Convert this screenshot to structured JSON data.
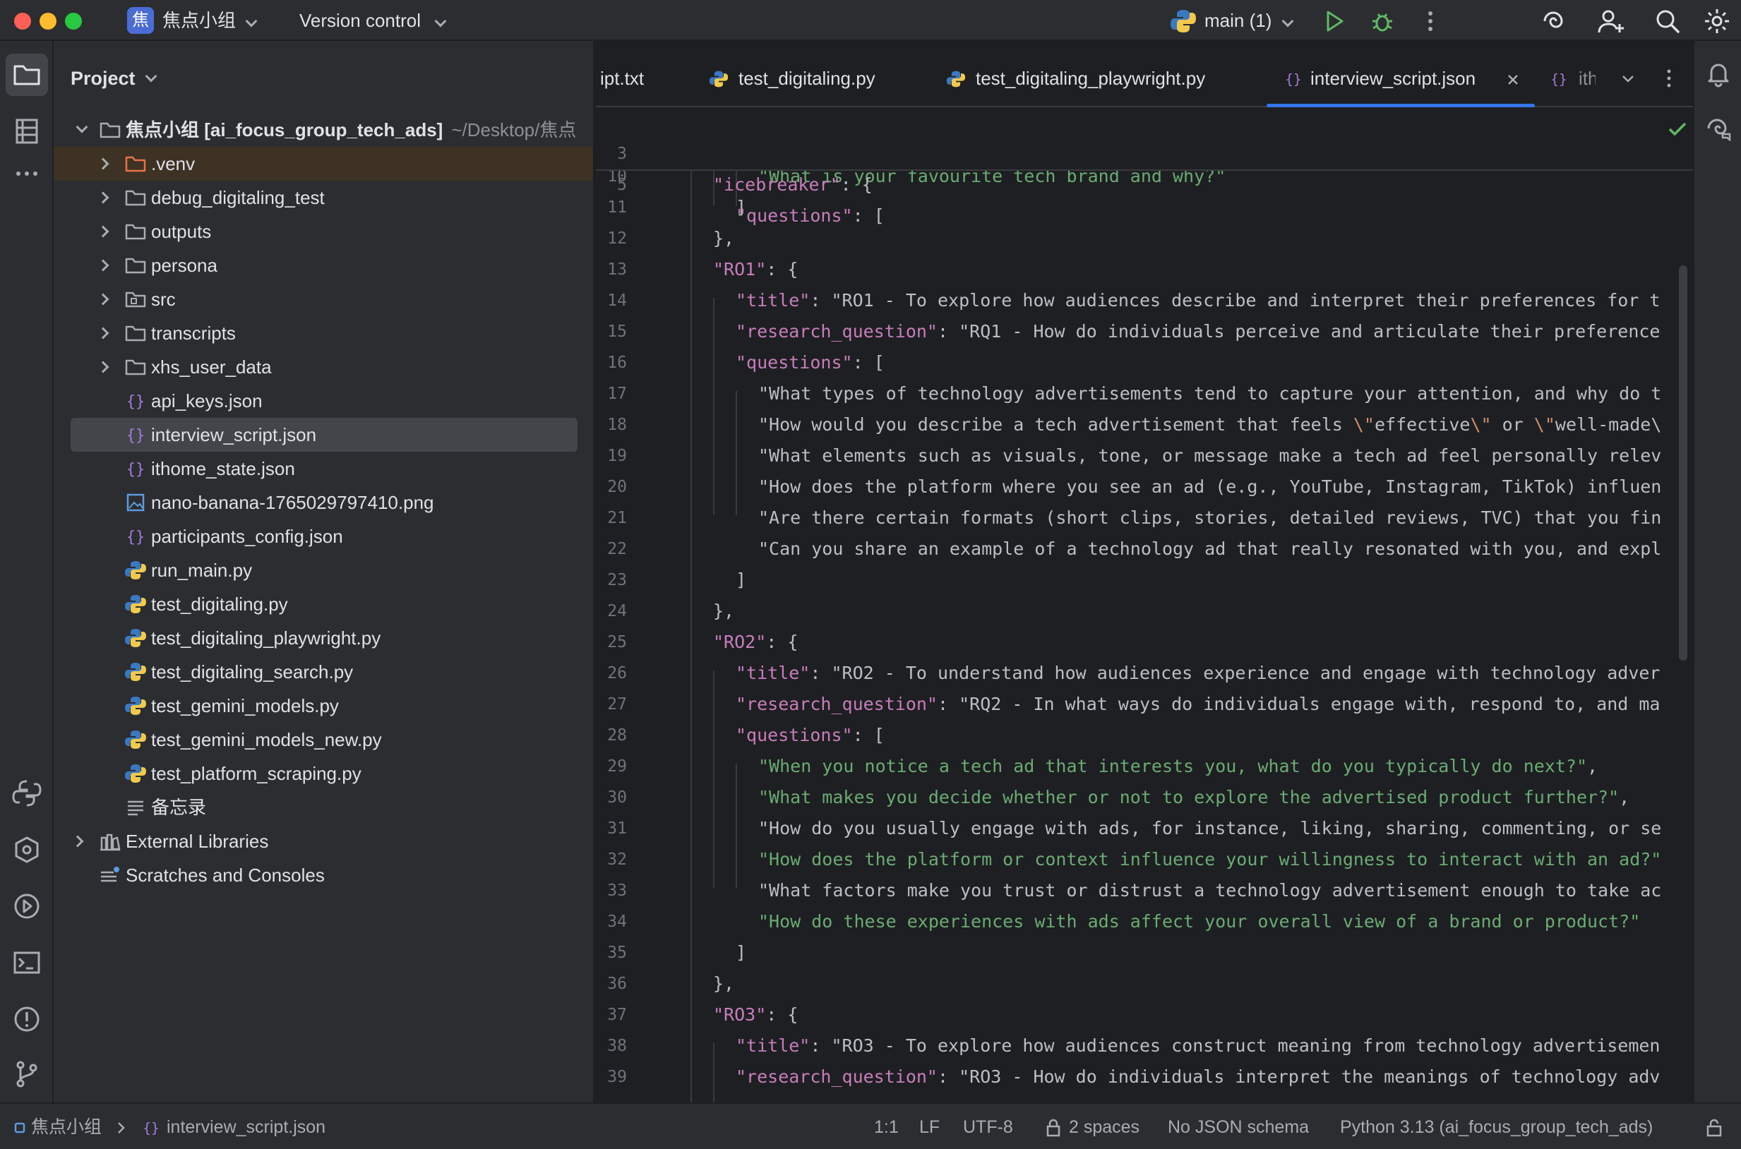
{
  "titlebar": {
    "project_badge": "焦",
    "project_name": "焦点小组",
    "vcs_label": "Version control",
    "run_config": "main (1)"
  },
  "project_panel": {
    "header": "Project",
    "root": {
      "label": "焦点小组 [ai_focus_group_tech_ads]",
      "path": "~/Desktop/焦点"
    },
    "items": [
      {
        "label": ".venv",
        "type": "folder-excluded"
      },
      {
        "label": "debug_digitaling_test",
        "type": "folder"
      },
      {
        "label": "outputs",
        "type": "folder"
      },
      {
        "label": "persona",
        "type": "folder"
      },
      {
        "label": "src",
        "type": "folder-src"
      },
      {
        "label": "transcripts",
        "type": "folder"
      },
      {
        "label": "xhs_user_data",
        "type": "folder"
      },
      {
        "label": "api_keys.json",
        "type": "json"
      },
      {
        "label": "interview_script.json",
        "type": "json"
      },
      {
        "label": "ithome_state.json",
        "type": "json"
      },
      {
        "label": "nano-banana-1765029797410.png",
        "type": "image"
      },
      {
        "label": "participants_config.json",
        "type": "json"
      },
      {
        "label": "run_main.py",
        "type": "python"
      },
      {
        "label": "test_digitaling.py",
        "type": "python"
      },
      {
        "label": "test_digitaling_playwright.py",
        "type": "python"
      },
      {
        "label": "test_digitaling_search.py",
        "type": "python"
      },
      {
        "label": "test_gemini_models.py",
        "type": "python"
      },
      {
        "label": "test_gemini_models_new.py",
        "type": "python"
      },
      {
        "label": "test_platform_scraping.py",
        "type": "python"
      },
      {
        "label": "备忘录",
        "type": "text"
      }
    ],
    "external_libraries": "External Libraries",
    "scratches": "Scratches and Consoles"
  },
  "tabs": [
    {
      "label": "ipt.txt",
      "icon": "text-file-icon"
    },
    {
      "label": "test_digitaling.py",
      "icon": "python-icon"
    },
    {
      "label": "test_digitaling_playwright.py",
      "icon": "python-icon"
    },
    {
      "label": "interview_script.json",
      "icon": "json-icon",
      "active": true
    },
    {
      "label": "ith",
      "icon": "json-icon"
    }
  ],
  "sticky_lines": [
    {
      "num": "3",
      "text": "\"icebreaker\": {"
    },
    {
      "num": "5",
      "text": "\"questions\": ["
    }
  ],
  "code_lines": [
    {
      "num": "10",
      "text": "\"What is your favourite tech brand and why?\""
    },
    {
      "num": "11",
      "text": "]"
    },
    {
      "num": "12",
      "text": "},"
    },
    {
      "num": "13",
      "text": "\"RO1\": {"
    },
    {
      "num": "14",
      "text": "\"title\": \"RO1 - To explore how audiences describe and interpret their preferences for t"
    },
    {
      "num": "15",
      "text": "\"research_question\": \"RQ1 - How do individuals perceive and articulate their preference"
    },
    {
      "num": "16",
      "text": "\"questions\": ["
    },
    {
      "num": "17",
      "text": "\"What types of technology advertisements tend to capture your attention, and why do t"
    },
    {
      "num": "18",
      "text": "\"How would you describe a tech advertisement that feels \\\"effective\\\" or \\\"well-made\\"
    },
    {
      "num": "19",
      "text": "\"What elements such as visuals, tone, or message make a tech ad feel personally relev"
    },
    {
      "num": "20",
      "text": "\"How does the platform where you see an ad (e.g., YouTube, Instagram, TikTok) influen"
    },
    {
      "num": "21",
      "text": "\"Are there certain formats (short clips, stories, detailed reviews, TVC) that you fin"
    },
    {
      "num": "22",
      "text": "\"Can you share an example of a technology ad that really resonated with you, and expl"
    },
    {
      "num": "23",
      "text": "]"
    },
    {
      "num": "24",
      "text": "},"
    },
    {
      "num": "25",
      "text": "\"RO2\": {"
    },
    {
      "num": "26",
      "text": "\"title\": \"RO2 - To understand how audiences experience and engage with technology adver"
    },
    {
      "num": "27",
      "text": "\"research_question\": \"RQ2 - In what ways do individuals engage with, respond to, and ma"
    },
    {
      "num": "28",
      "text": "\"questions\": ["
    },
    {
      "num": "29",
      "text": "\"When you notice a tech ad that interests you, what do you typically do next?\","
    },
    {
      "num": "30",
      "text": "\"What makes you decide whether or not to explore the advertised product further?\","
    },
    {
      "num": "31",
      "text": "\"How do you usually engage with ads, for instance, liking, sharing, commenting, or se"
    },
    {
      "num": "32",
      "text": "\"How does the platform or context influence your willingness to interact with an ad?\""
    },
    {
      "num": "33",
      "text": "\"What factors make you trust or distrust a technology advertisement enough to take ac"
    },
    {
      "num": "34",
      "text": "\"How do these experiences with ads affect your overall view of a brand or product?\""
    },
    {
      "num": "35",
      "text": "]"
    },
    {
      "num": "36",
      "text": "},"
    },
    {
      "num": "37",
      "text": "\"RO3\": {"
    },
    {
      "num": "38",
      "text": "\"title\": \"RO3 - To explore how audiences construct meaning from technology advertisemen"
    },
    {
      "num": "39",
      "text": "\"research_question\": \"RO3 - How do individuals interpret the meanings of technology adv"
    }
  ],
  "statusbar": {
    "breadcrumb_project": "焦点小组",
    "breadcrumb_file": "interview_script.json",
    "position": "1:1",
    "line_sep": "LF",
    "encoding": "UTF-8",
    "indent": "2 spaces",
    "schema": "No JSON schema",
    "interpreter": "Python 3.13 (ai_focus_group_tech_ads)"
  }
}
